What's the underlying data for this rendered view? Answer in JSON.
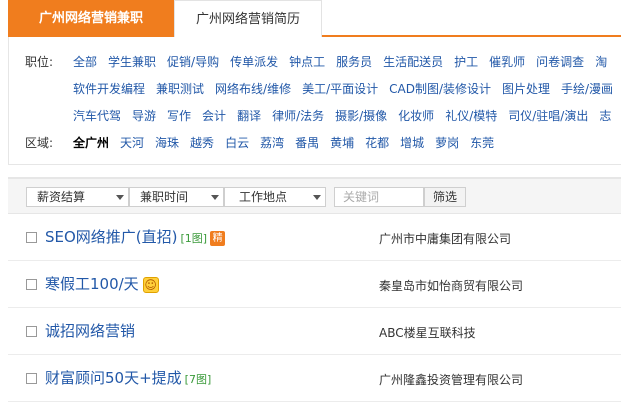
{
  "tabs": {
    "active": "广州网络营销兼职",
    "inactive": "广州网络营销简历"
  },
  "filters": {
    "position_label": "职位:",
    "position_row1": [
      "全部",
      "学生兼职",
      "促销/导购",
      "传单派发",
      "钟点工",
      "服务员",
      "生活配送员",
      "护工",
      "催乳师",
      "问卷调查",
      "淘"
    ],
    "position_row2": [
      "软件开发编程",
      "兼职测试",
      "网络布线/维修",
      "美工/平面设计",
      "CAD制图/装修设计",
      "图片处理",
      "手绘/漫画"
    ],
    "position_row3": [
      "汽车代驾",
      "导游",
      "写作",
      "会计",
      "翻译",
      "律师/法务",
      "摄影/摄像",
      "化妆师",
      "礼仪/模特",
      "司仪/驻唱/演出",
      "志"
    ],
    "area_label": "区域:",
    "areas": [
      "全广州",
      "天河",
      "海珠",
      "越秀",
      "白云",
      "荔湾",
      "番禺",
      "黄埔",
      "花都",
      "增城",
      "萝岗",
      "东莞"
    ]
  },
  "toolbar": {
    "salary": "薪资结算",
    "time": "兼职时间",
    "location": "工作地点",
    "keyword_placeholder": "关键词",
    "filter_button": "筛选"
  },
  "listings": [
    {
      "title": "SEO网络推广(直招)",
      "pics": "[1图]",
      "badge": "精",
      "company": "广州市中庸集团有限公司"
    },
    {
      "title": "寒假工100/天",
      "pics": "",
      "badge": "smile",
      "company": "秦皇岛市如怡商贸有限公司"
    },
    {
      "title": "诚招网络营销",
      "pics": "",
      "badge": "",
      "company": "ABC楼星互联科技"
    },
    {
      "title": "财富顾问50天+提成",
      "pics": "[7图]",
      "badge": "",
      "company": "广州隆鑫投资管理有限公司"
    }
  ],
  "colors": {
    "accent": "#f07d1e",
    "link": "#2258a8"
  },
  "icons": {
    "smile": "☺"
  }
}
